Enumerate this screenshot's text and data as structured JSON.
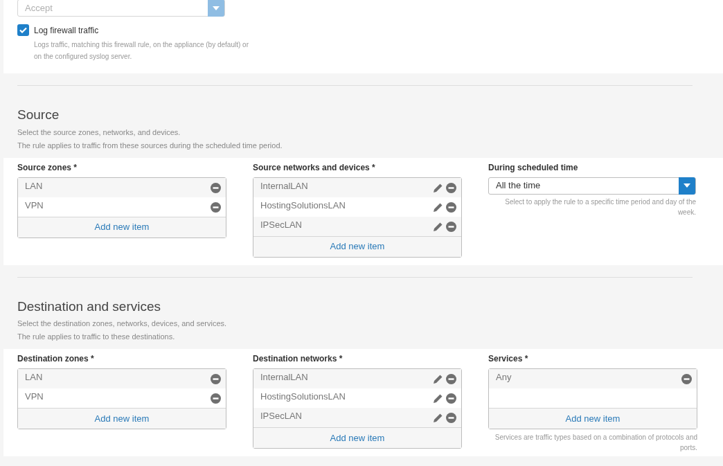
{
  "action_select": {
    "value": "Accept",
    "disabled": true
  },
  "log_traffic": {
    "label": "Log firewall traffic",
    "checked": true,
    "hint": "Logs traffic, matching this firewall rule, on the appliance (by default) or on the configured syslog server."
  },
  "sections": [
    {
      "title": "Source",
      "description": [
        "Select the source zones, networks, and devices.",
        "The rule applies to traffic from these sources during the scheduled time period."
      ],
      "fields": [
        {
          "kind": "list",
          "label": "Source zones *",
          "items": [
            {
              "text": "LAN",
              "editable": false
            },
            {
              "text": "VPN",
              "editable": false
            }
          ],
          "add_label": "Add new item"
        },
        {
          "kind": "list",
          "label": "Source networks and devices *",
          "items": [
            {
              "text": "InternalLAN",
              "editable": true
            },
            {
              "text": "HostingSolutionsLAN",
              "editable": true
            },
            {
              "text": "IPSecLAN",
              "editable": true
            }
          ],
          "add_label": "Add new item"
        },
        {
          "kind": "select",
          "label": "During scheduled time",
          "value": "All the time",
          "disabled": false,
          "hint": "Select to apply the rule to a specific time period and day of the week."
        }
      ]
    },
    {
      "title": "Destination and services",
      "description": [
        "Select the destination zones, networks, devices, and services.",
        "The rule applies to traffic to these destinations."
      ],
      "fields": [
        {
          "kind": "list",
          "label": "Destination zones *",
          "items": [
            {
              "text": "LAN",
              "editable": false
            },
            {
              "text": "VPN",
              "editable": false
            }
          ],
          "add_label": "Add new item"
        },
        {
          "kind": "list",
          "label": "Destination networks *",
          "items": [
            {
              "text": "InternalLAN",
              "editable": true
            },
            {
              "text": "HostingSolutionsLAN",
              "editable": true
            },
            {
              "text": "IPSecLAN",
              "editable": true
            }
          ],
          "add_label": "Add new item"
        },
        {
          "kind": "list",
          "label": "Services *",
          "items": [
            {
              "text": "Any",
              "editable": false
            }
          ],
          "add_label": "Add new item",
          "hint": "Services are traffic types based on a combination of protocols and ports."
        }
      ]
    }
  ]
}
